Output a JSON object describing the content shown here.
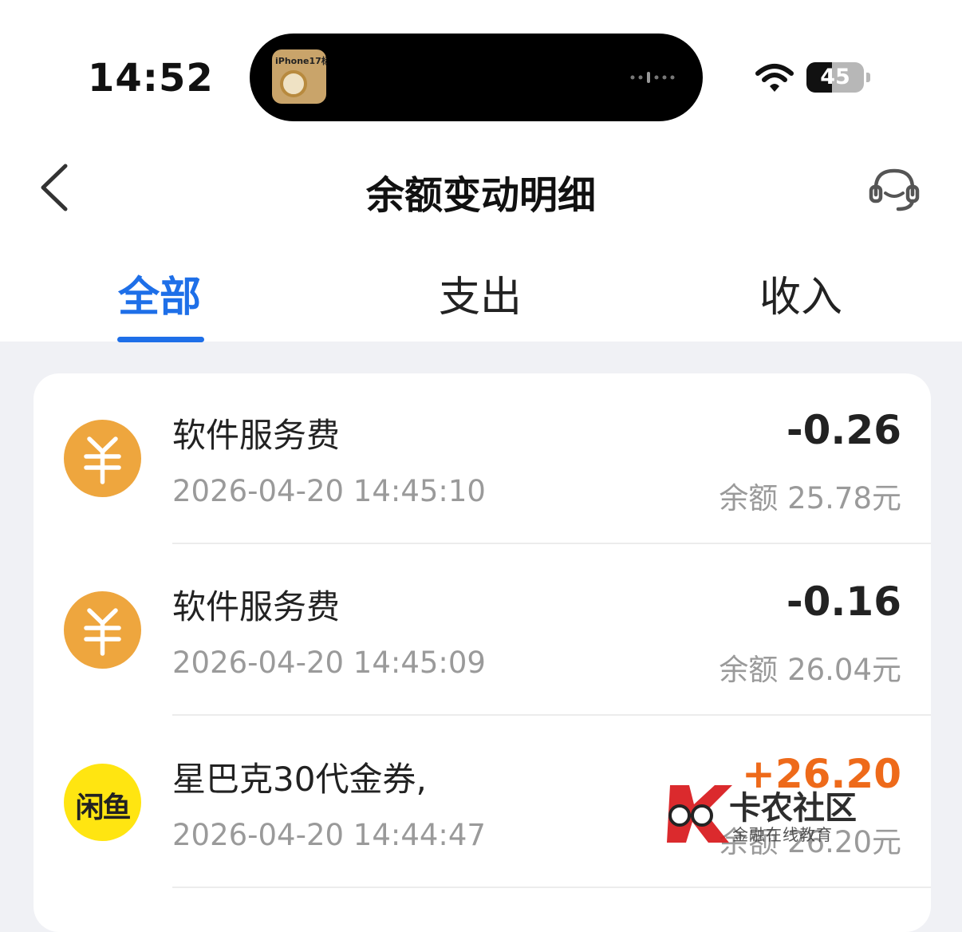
{
  "status_bar": {
    "time": "14:52",
    "island_thumb_label": "iPhone17标",
    "battery_percent": "45",
    "battery_level": 0.45
  },
  "header": {
    "title": "余额变动明细",
    "back_icon": "chevron-left-icon",
    "service_icon": "customer-service-headset-icon"
  },
  "tabs": [
    {
      "label": "全部",
      "active": true
    },
    {
      "label": "支出",
      "active": false
    },
    {
      "label": "收入",
      "active": false
    }
  ],
  "colors": {
    "accent": "#1e6fe8",
    "income": "#ee6a1a",
    "yen_icon_bg": "#eea63e",
    "xianyu_icon_bg": "#ffe511"
  },
  "records": [
    {
      "icon": "yen-icon",
      "name": "软件服务费",
      "datetime": "2026-04-20 14:45:10",
      "amount": "-0.26",
      "balance": "余额 25.78元"
    },
    {
      "icon": "yen-icon",
      "name": "软件服务费",
      "datetime": "2026-04-20 14:45:09",
      "amount": "-0.16",
      "balance": "余额 26.04元"
    },
    {
      "icon": "xianyu-icon",
      "icon_text": "闲鱼",
      "name": "星巴克30代金券,",
      "datetime": "2026-04-20 14:44:47",
      "amount": "+26.20",
      "balance": "余额 26.20元"
    }
  ],
  "watermark": {
    "title": "卡农社区",
    "subtitle": "金融在线教育"
  }
}
